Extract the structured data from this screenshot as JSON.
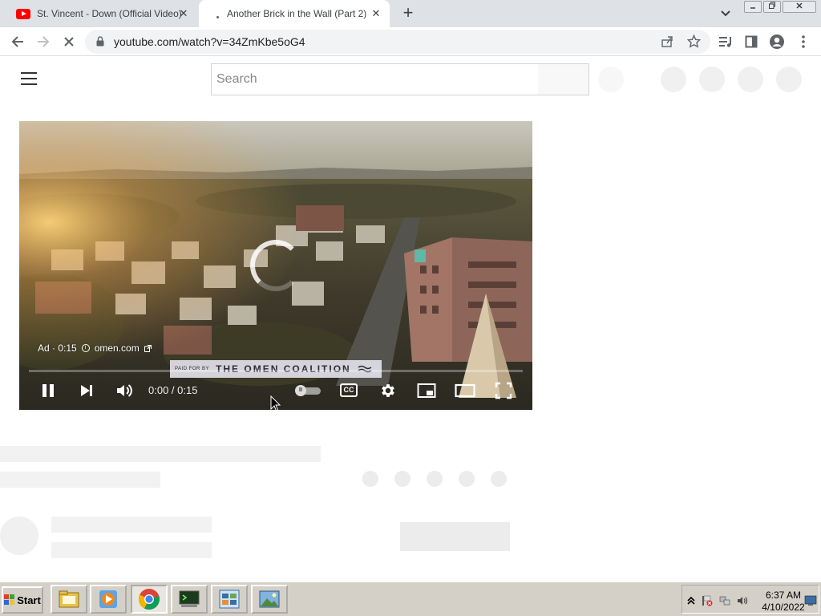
{
  "browser": {
    "tabs": [
      {
        "title": "St. Vincent - Down (Official Video)",
        "favicon": "youtube-icon",
        "active": false
      },
      {
        "title": "Another Brick in the Wall (Part 2)",
        "favicon": "loading-icon",
        "active": true
      }
    ],
    "close_glyph": "✕",
    "new_tab_glyph": "+",
    "url": "youtube.com/watch?v=34ZmKbe5oG4"
  },
  "youtube": {
    "search_placeholder": "Search",
    "player": {
      "ad_label": "Ad · 0:15",
      "ad_domain": "omen.com",
      "sponsor_prefix": "PAID FOR BY",
      "sponsor_name": "THE OMEN COALITION",
      "time": "0:00 / 0:15",
      "progress": 0.0,
      "autoplay": "on",
      "cc_label": "CC"
    }
  },
  "taskbar": {
    "start_label": "Start",
    "apps": [
      "file-manager-icon",
      "media-player-icon",
      "chrome-icon",
      "terminal-icon",
      "control-panel-icon",
      "image-viewer-icon"
    ],
    "active_app": "chrome-icon",
    "time": "6:37 AM",
    "date": "4/10/2022"
  },
  "colors": {
    "progress": "#fcd000",
    "youtube_red": "#ff0000",
    "chrome_tabstrip": "#dee1e6"
  }
}
